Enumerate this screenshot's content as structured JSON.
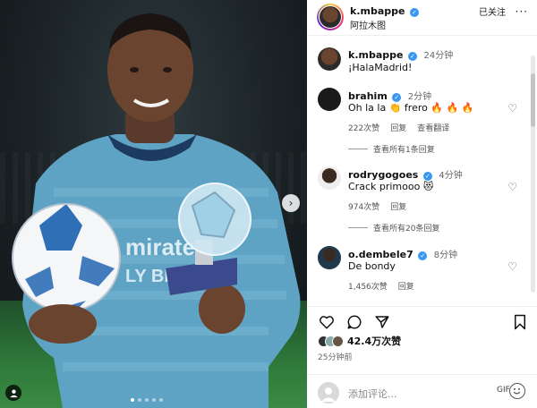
{
  "post": {
    "author": "k.mbappe",
    "location": "阿拉木图",
    "follow_label": "已关注",
    "more_label": "···",
    "caption_author": "k.mbappe",
    "caption_time": "24分钟",
    "caption": "¡HalaMadrid!"
  },
  "comments": [
    {
      "user": "brahim",
      "time": "2分钟",
      "text_prefix": "Oh la la ",
      "emoji_clap": "👏",
      "text_suffix": " frero ",
      "emoji_fire": "🔥 🔥 🔥",
      "likes": "222次赞",
      "reply": "回复",
      "translate": "查看翻译",
      "view_replies": "查看所有1条回复"
    },
    {
      "user": "rodrygogoes",
      "time": "4分钟",
      "text": "Crack primooo ",
      "emoji": "😻",
      "likes": "974次赞",
      "reply": "回复",
      "view_replies": "查看所有20条回复"
    },
    {
      "user": "o.dembele7",
      "time": "8分钟",
      "text": "De bondy",
      "likes": "1,456次赞",
      "reply": "回复"
    }
  ],
  "footer": {
    "likes": "42.4万次赞",
    "posted": "25分钟前",
    "comment_placeholder": "添加评论...",
    "gif_label": "GIF"
  },
  "colors": {
    "verified": "#3897f0",
    "jersey": "#5fa8c8"
  },
  "icons": [
    "heart-icon",
    "comment-icon",
    "share-icon",
    "bookmark-icon",
    "emoji-icon",
    "chevron-right-icon",
    "user-tag-icon"
  ]
}
